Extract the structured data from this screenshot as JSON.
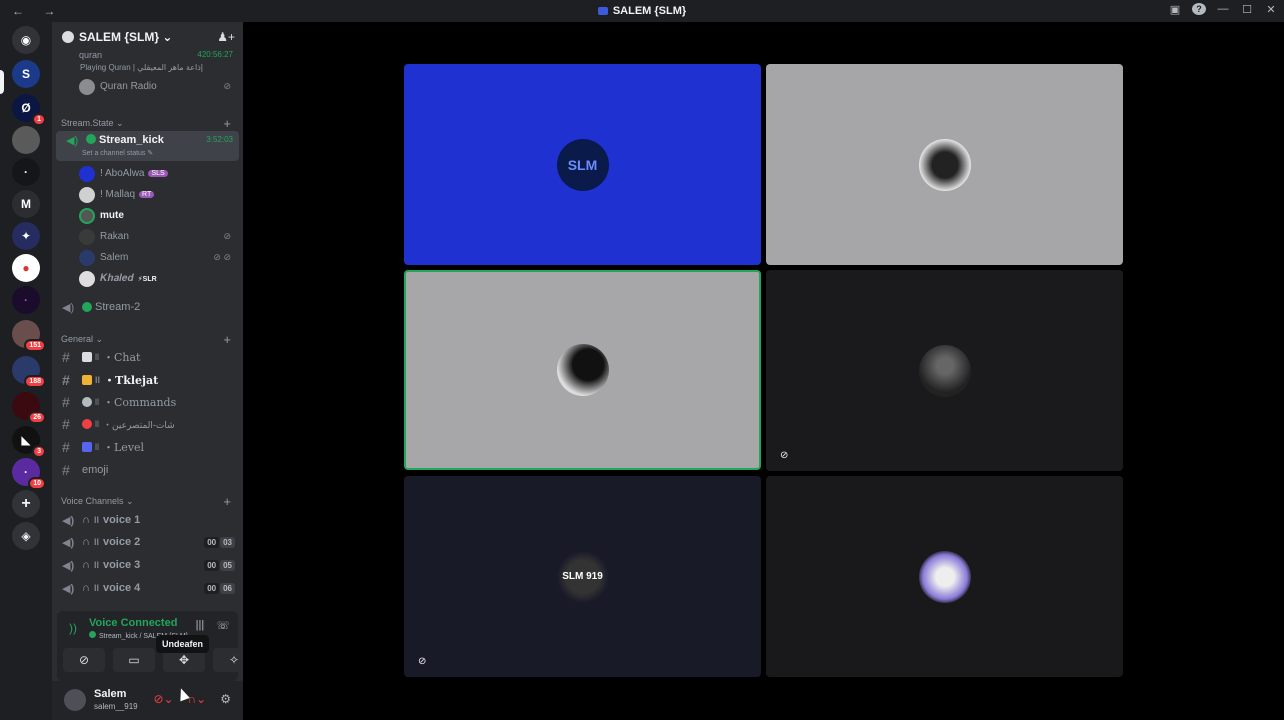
{
  "window": {
    "title": "SALEM {SLM}",
    "nav": "← →"
  },
  "rail": {
    "badges": [
      "1",
      "151",
      "188",
      "26",
      "3",
      "10"
    ]
  },
  "server": {
    "name": "SALEM {SLM} ⌄"
  },
  "top_channel": {
    "name": "quran",
    "timer": "420:56:27",
    "activity": "Playing Quran | إذاعة ماهر المعيقلي",
    "user": "Quran Radio"
  },
  "categories": {
    "stream_state": "Stream.State ⌄",
    "general": "General ⌄",
    "voice": "Voice Channels ⌄"
  },
  "stream_kick": {
    "name": "Stream_kick",
    "timer": "3:52:03",
    "status": "Set a channel status ✎",
    "users": [
      {
        "name": "! AboAlwa",
        "tag": "SLS"
      },
      {
        "name": "! Mallaq",
        "tag": "RT"
      },
      {
        "name": "mute",
        "tag": ""
      },
      {
        "name": "Rakan",
        "tag": ""
      },
      {
        "name": "Salem",
        "tag": ""
      },
      {
        "name": "𝑲𝒉𝒂𝒍𝒆𝒅",
        "tag": "⚡SLR"
      }
    ]
  },
  "stream2": {
    "name": "Stream-2"
  },
  "text_channels": [
    {
      "bars": "ll",
      "name": "・Chat"
    },
    {
      "bars": "ll",
      "name": "・Tklejat"
    },
    {
      "bars": "ll",
      "name": "・Commands"
    },
    {
      "bars": "ll",
      "name": "・شات-المتصرعين"
    },
    {
      "bars": "ll",
      "name": "・Level"
    },
    {
      "bars": "",
      "name": "emoji"
    }
  ],
  "voice_channels": [
    {
      "name": "voice 1",
      "count": [
        "",
        ""
      ]
    },
    {
      "name": "voice 2",
      "count": [
        "00",
        "03"
      ]
    },
    {
      "name": "voice 3",
      "count": [
        "00",
        "05"
      ]
    },
    {
      "name": "voice 4",
      "count": [
        "00",
        "06"
      ]
    }
  ],
  "voice_panel": {
    "title": "Voice Connected",
    "subtitle": "Stream_kick / SALEM {SLM}"
  },
  "tooltip": "Undeafen",
  "user": {
    "name": "Salem",
    "handle": "salem__919"
  },
  "tiles": [
    {
      "label": "SLM"
    },
    {
      "label": ""
    },
    {
      "label": ""
    },
    {
      "label": ""
    },
    {
      "label": "SLM 919"
    },
    {
      "label": ""
    }
  ],
  "colors": {
    "accent": "#23a55a",
    "tile_blue": "#1f32d1",
    "danger": "#f23f43"
  }
}
